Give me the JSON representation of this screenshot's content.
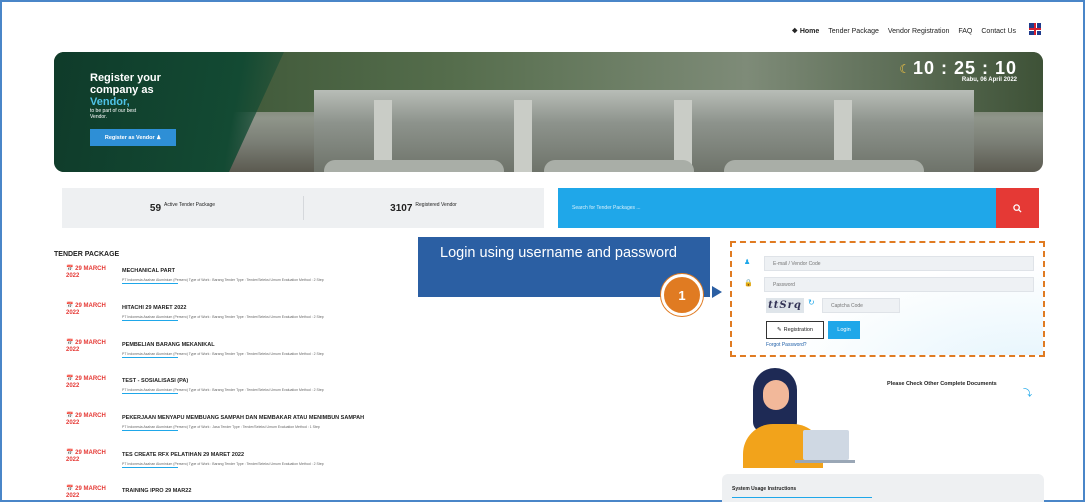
{
  "nav": {
    "home": "Home",
    "items": [
      "Tender Package",
      "Vendor Registration",
      "FAQ",
      "Contact Us"
    ]
  },
  "hero": {
    "title_line1": "Register your",
    "title_line2": "company as",
    "title_vendor": "Vendor,",
    "subtitle": "to be part of our best Vendor.",
    "cta": "Register as Vendor",
    "clock": "10 : 25 : 10",
    "date": "Rabu, 06 April 2022"
  },
  "stats": {
    "active_count": "59",
    "active_label": "Active Tender Package",
    "vendor_count": "3107",
    "vendor_label": "Registered Vendor"
  },
  "search": {
    "placeholder": "Search for Tender Packages ..."
  },
  "tender_section": {
    "title": "TENDER PACKAGE",
    "items": [
      {
        "date": "29 MARCH 2022",
        "name": "MECHANICAL PART",
        "meta": "PT Indonesia Asahan Aluminium (Persero)   Type of Work : Barang   Tender Type : Tender/Seleksi Umum   Evaluation Method : 2 Step"
      },
      {
        "date": "29 MARCH 2022",
        "name": "HITACHI 29 MARET 2022",
        "meta": "PT Indonesia Asahan Aluminium (Persero)   Type of Work : Barang   Tender Type : Tender/Seleksi Umum   Evaluation Method : 2 Step"
      },
      {
        "date": "29 MARCH 2022",
        "name": "PEMBELIAN BARANG MEKANIKAL",
        "meta": "PT Indonesia Asahan Aluminium (Persero)   Type of Work : Barang   Tender Type : Tender/Seleksi Umum   Evaluation Method : 2 Step"
      },
      {
        "date": "29 MARCH 2022",
        "name": "TEST - SOSIALISASI (PA)",
        "meta": "PT Indonesia Asahan Aluminium (Persero)   Type of Work : Barang   Tender Type : Tender/Seleksi Umum   Evaluation Method : 2 Step"
      },
      {
        "date": "29 MARCH 2022",
        "name": "PEKERJAAN MENYAPU MEMBUANG SAMPAH DAN MEMBAKAR ATAU MENIMBUN SAMPAH",
        "meta": "PT Indonesia Asahan Aluminium (Persero)   Type of Work : Jasa   Tender Type : Tender/Seleksi Umum   Evaluation Method : 1 Step"
      },
      {
        "date": "29 MARCH 2022",
        "name": "TES CREATE RFX PELATIHAN 29 MARET 2022",
        "meta": "PT Indonesia Asahan Aluminium (Persero)   Type of Work : Barang   Tender Type : Tender/Seleksi Umum   Evaluation Method : 2 Step"
      },
      {
        "date": "29 MARCH 2022",
        "name": "TRAINING IPRO 29 MAR22",
        "meta": ""
      }
    ]
  },
  "callout": {
    "text": "Login using username and password",
    "step": "1"
  },
  "login": {
    "email_placeholder": "E-mail / Vendor Code",
    "password_placeholder": "Password",
    "captcha_text": "ttSrq",
    "captcha_placeholder": "Captcha Code",
    "registration": "Registration",
    "login": "Login",
    "forgot": "Forgot Password?"
  },
  "side": {
    "check_docs": "Please Check Other Complete Documents",
    "instructions_title": "System Usage Instructions"
  },
  "colors": {
    "accent": "#1fa7e9",
    "danger": "#e53935",
    "callout": "#2b5fa3",
    "highlight": "#e07b22"
  }
}
